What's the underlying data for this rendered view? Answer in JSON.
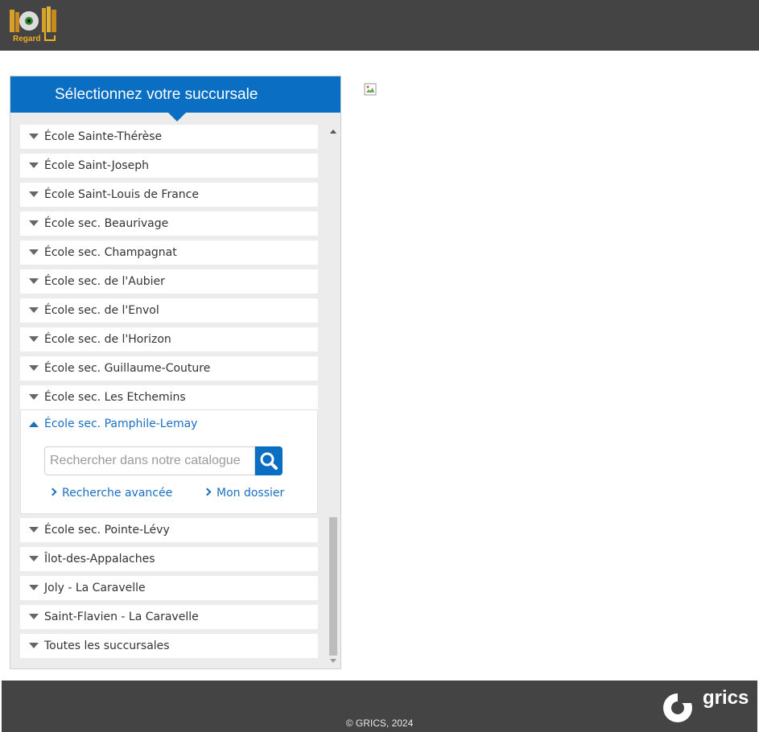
{
  "header": {
    "logo_text": "Regard"
  },
  "panel": {
    "title": "Sélectionnez votre succursale",
    "items_before": [
      "École Sainte-Thérèse",
      "École Saint-Joseph",
      "École Saint-Louis de France",
      "École sec. Beaurivage",
      "École sec. Champagnat",
      "École sec. de l'Aubier",
      "École sec. de l'Envol",
      "École sec. de l'Horizon",
      "École sec. Guillaume-Couture",
      "École sec. Les Etchemins"
    ],
    "expanded": {
      "label": "École sec. Pamphile-Lemay",
      "search_placeholder": "Rechercher dans notre catalogue",
      "advanced_search": "Recherche avancée",
      "my_account": "Mon dossier"
    },
    "items_after": [
      "École sec. Pointe-Lévy",
      "Îlot-des-Appalaches",
      "Joly - La Caravelle",
      "Saint-Flavien - La Caravelle",
      "Toutes les succursales"
    ]
  },
  "footer": {
    "copyright": "© GRICS, 2024",
    "brand": "grics"
  },
  "colors": {
    "accent": "#0a6fc2",
    "header_bg": "#444444"
  }
}
